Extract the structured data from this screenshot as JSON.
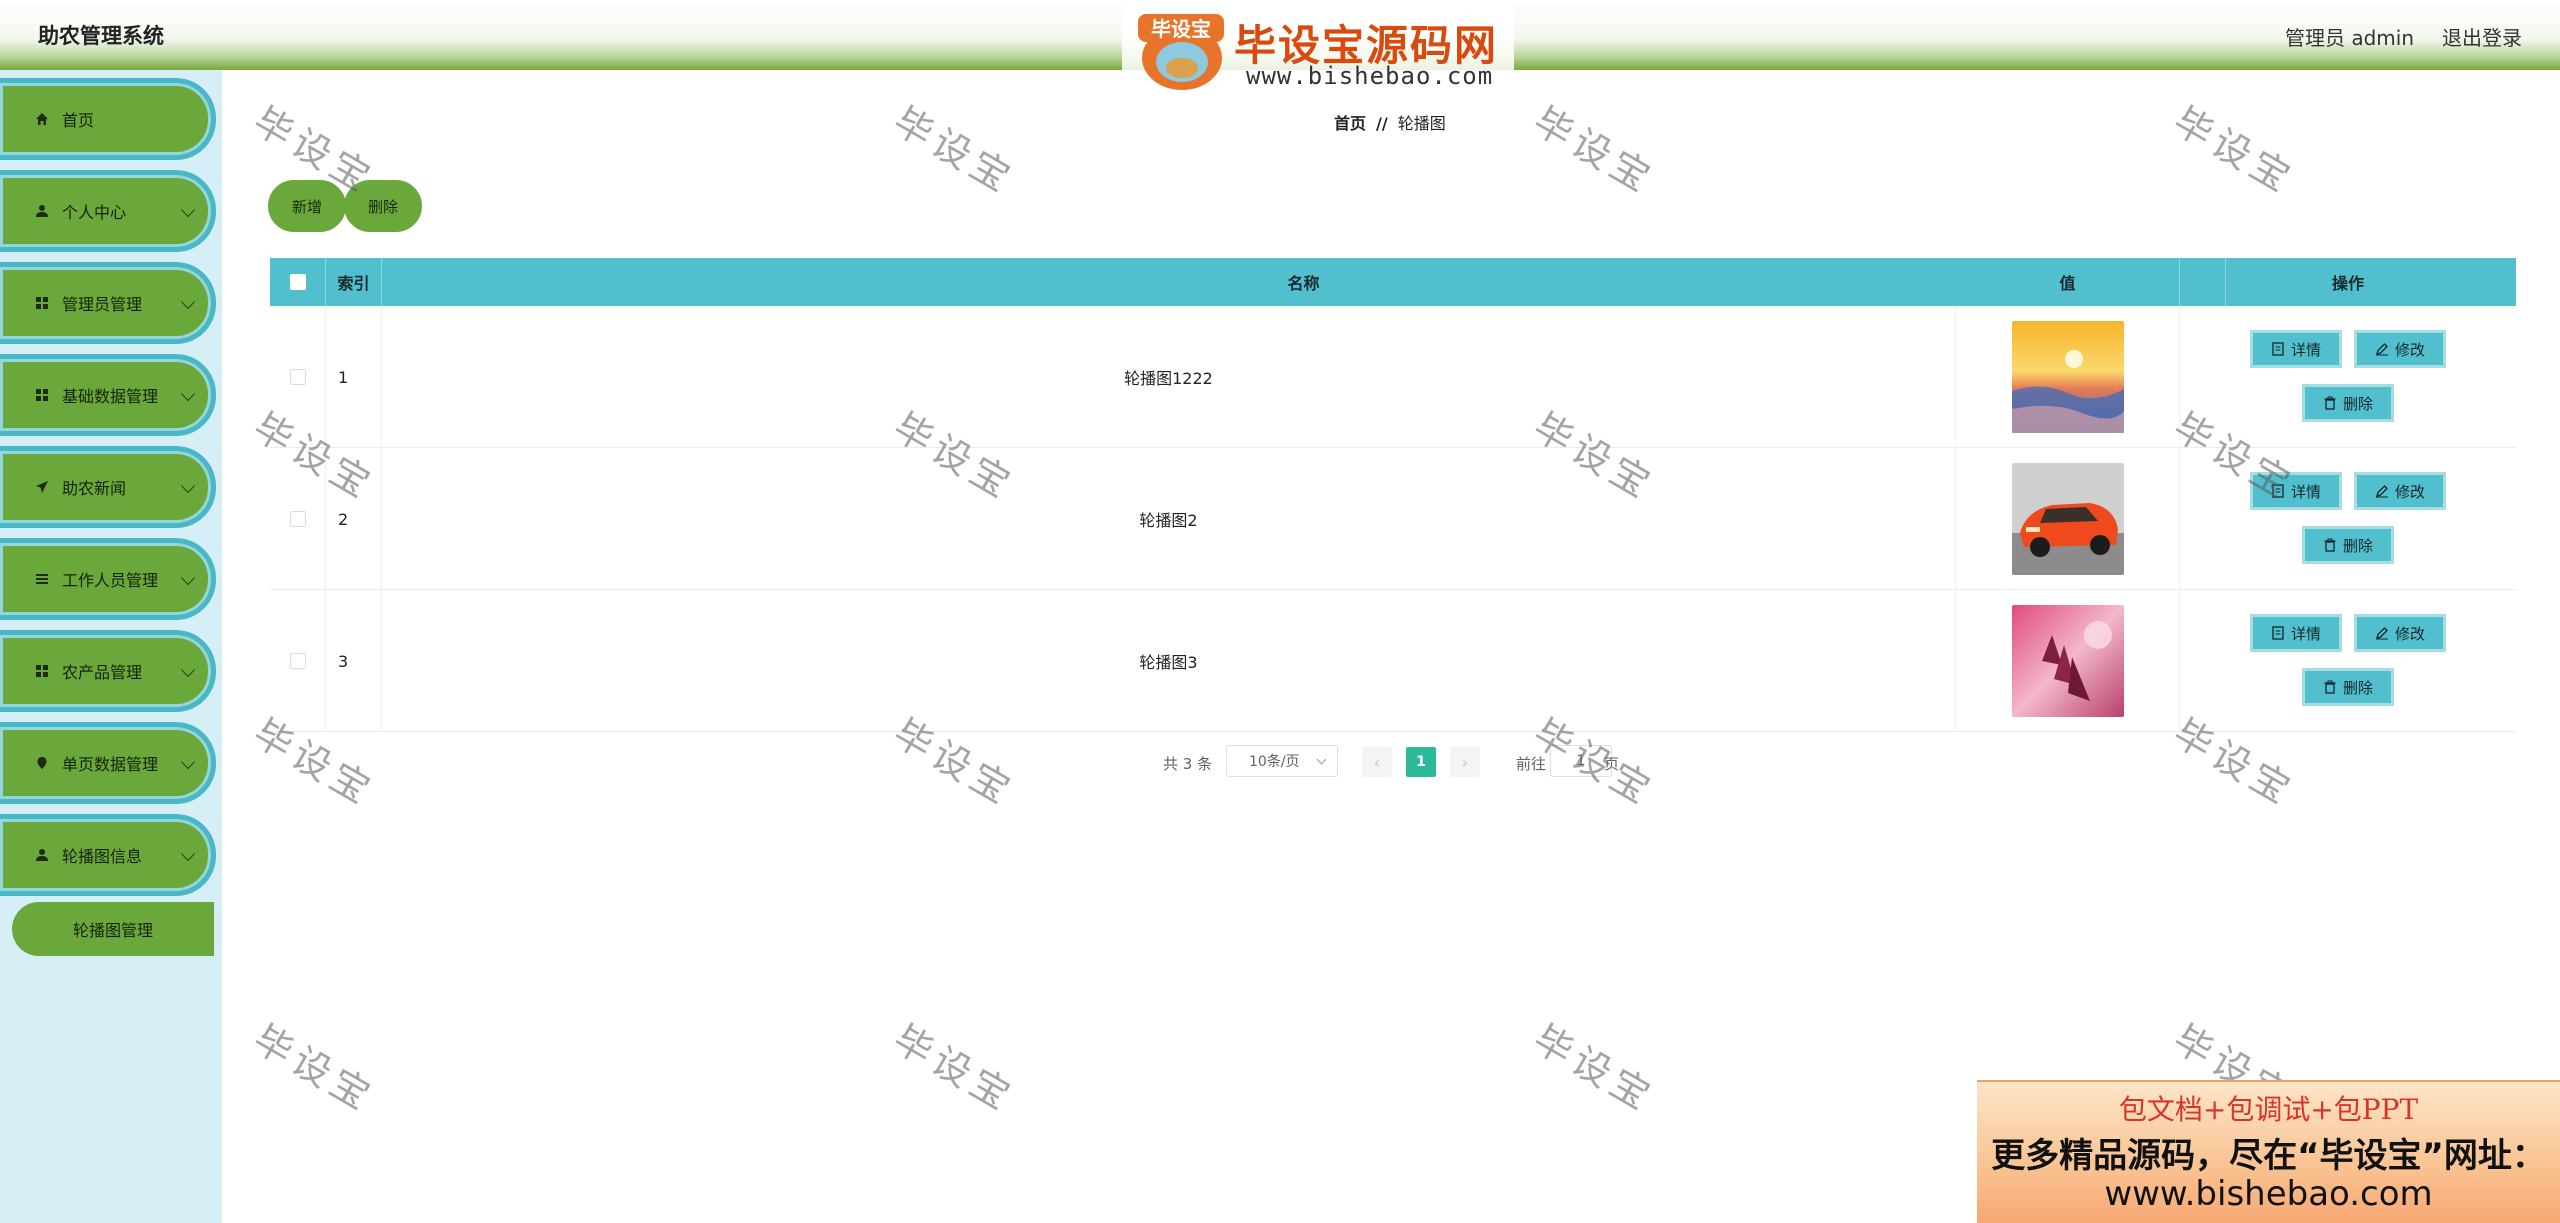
{
  "header": {
    "app_title": "助农管理系统",
    "user_label": "管理员 admin",
    "logout_label": "退出登录",
    "logo_badge": "毕设宝",
    "logo_text": "毕设宝源码网",
    "logo_url": "www.bishebao.com"
  },
  "sidebar": {
    "items": [
      {
        "label": "首页",
        "icon": "home-icon"
      },
      {
        "label": "个人中心",
        "icon": "user-icon"
      },
      {
        "label": "管理员管理",
        "icon": "grid-icon"
      },
      {
        "label": "基础数据管理",
        "icon": "grid-icon"
      },
      {
        "label": "助农新闻",
        "icon": "send-icon"
      },
      {
        "label": "工作人员管理",
        "icon": "list-icon"
      },
      {
        "label": "农产品管理",
        "icon": "grid-icon"
      },
      {
        "label": "单页数据管理",
        "icon": "location-icon"
      },
      {
        "label": "轮播图信息",
        "icon": "user-icon"
      }
    ],
    "sub_item": "轮播图管理"
  },
  "breadcrumb": {
    "home": "首页",
    "separator": "//",
    "current": "轮播图"
  },
  "toolbar": {
    "add_label": "新增",
    "delete_label": "删除"
  },
  "table": {
    "columns": [
      "索引",
      "名称",
      "值",
      "操作"
    ],
    "rows": [
      {
        "index": "1",
        "name": "轮播图1222"
      },
      {
        "index": "2",
        "name": "轮播图2"
      },
      {
        "index": "3",
        "name": "轮播图3"
      }
    ],
    "actions": {
      "detail": "详情",
      "edit": "修改",
      "delete": "删除"
    }
  },
  "pagination": {
    "total": "共 3 条",
    "page_size": "10条/页",
    "current_page": "1",
    "goto_prefix": "前往",
    "goto_value": "1",
    "goto_suffix": "页"
  },
  "watermark": "毕设宝",
  "promo": {
    "line1": "包文档+包调试+包PPT",
    "line2": "更多精品源码，尽在“毕设宝”网址：",
    "line3": "www.bishebao.com"
  },
  "colors": {
    "menu_green": "#6aa83c",
    "table_header": "#51bfcd",
    "sidebar_bg": "#d6eef6",
    "pager_active": "#2fb99b"
  }
}
